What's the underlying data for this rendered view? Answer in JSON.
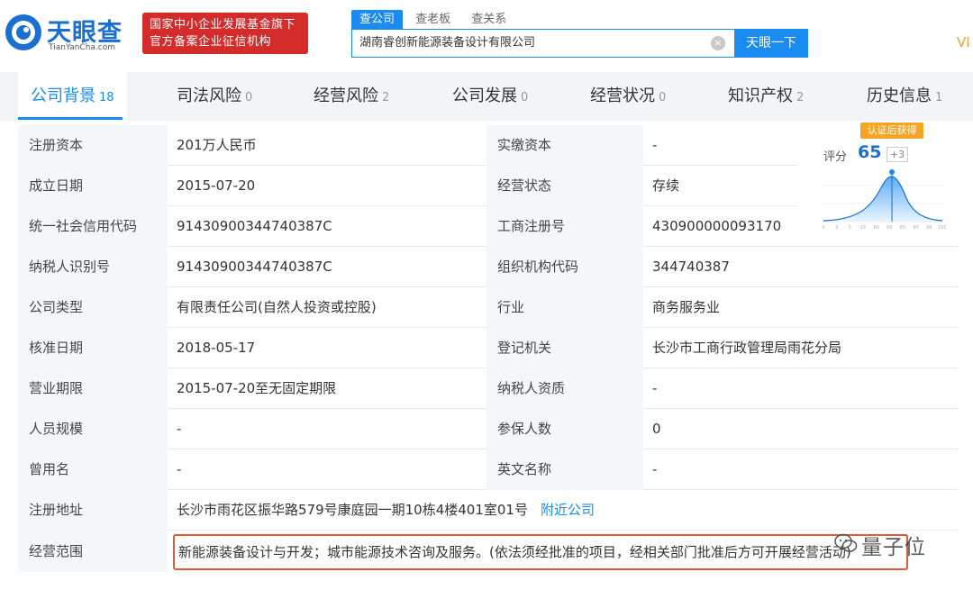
{
  "brand": {
    "name": "天眼查",
    "domain": "TianYanCha.com",
    "badge_line1": "国家中小企业发展基金旗下",
    "badge_line2": "官方备案企业征信机构"
  },
  "search": {
    "tabs": [
      "查公司",
      "查老板",
      "查关系"
    ],
    "value": "湖南睿创新能源装备设计有限公司",
    "button": "天眼一下",
    "clear_icon": "×"
  },
  "vip_label": "VI",
  "nav_tabs": [
    {
      "label": "公司背景",
      "count": "18"
    },
    {
      "label": "司法风险",
      "count": "0"
    },
    {
      "label": "经营风险",
      "count": "2"
    },
    {
      "label": "公司发展",
      "count": "0"
    },
    {
      "label": "经营状况",
      "count": "0"
    },
    {
      "label": "知识产权",
      "count": "2"
    },
    {
      "label": "历史信息",
      "count": "1"
    }
  ],
  "info_rows": [
    {
      "k1": "注册资本",
      "v1": "201万人民币",
      "k2": "实缴资本",
      "v2": "-"
    },
    {
      "k1": "成立日期",
      "v1": "2015-07-20",
      "k2": "经营状态",
      "v2": "存续"
    },
    {
      "k1": "统一社会信用代码",
      "v1": "91430900344740387C",
      "k2": "工商注册号",
      "v2": "430900000093170"
    },
    {
      "k1": "纳税人识别号",
      "v1": "91430900344740387C",
      "k2": "组织机构代码",
      "v2": "344740387"
    },
    {
      "k1": "公司类型",
      "v1": "有限责任公司(自然人投资或控股)",
      "k2": "行业",
      "v2": "商务服务业"
    },
    {
      "k1": "核准日期",
      "v1": "2018-05-17",
      "k2": "登记机关",
      "v2": "长沙市工商行政管理局雨花分局"
    },
    {
      "k1": "营业期限",
      "v1": "2015-07-20至无固定期限",
      "k2": "纳税人资质",
      "v2": "-"
    },
    {
      "k1": "人员规模",
      "v1": "-",
      "k2": "参保人数",
      "v2": "0"
    },
    {
      "k1": "曾用名",
      "v1": "-",
      "k2": "英文名称",
      "v2": "-"
    }
  ],
  "address": {
    "label": "注册地址",
    "value": "长沙市雨花区振华路579号康庭园一期10栋4楼401室01号",
    "link": "附近公司"
  },
  "scope": {
    "label": "经营范围",
    "value": "新能源装备设计与开发；城市能源技术咨询及服务。(依法须经批准的项目，经相关部门批准后方可开展经营活动)"
  },
  "rating": {
    "cert_tag": "认证后获得",
    "label": "评分",
    "score": "65",
    "delta": "+3",
    "axis_ticks": [
      "0",
      "3",
      "5",
      "15",
      "60",
      "65",
      "85",
      "97",
      "99",
      "100"
    ]
  },
  "watermark": "量子位",
  "colors": {
    "brand_blue": "#1a8bf0",
    "badge_red": "#d42b2b",
    "highlight": "#e05a35",
    "cert_orange": "#f5a524"
  }
}
